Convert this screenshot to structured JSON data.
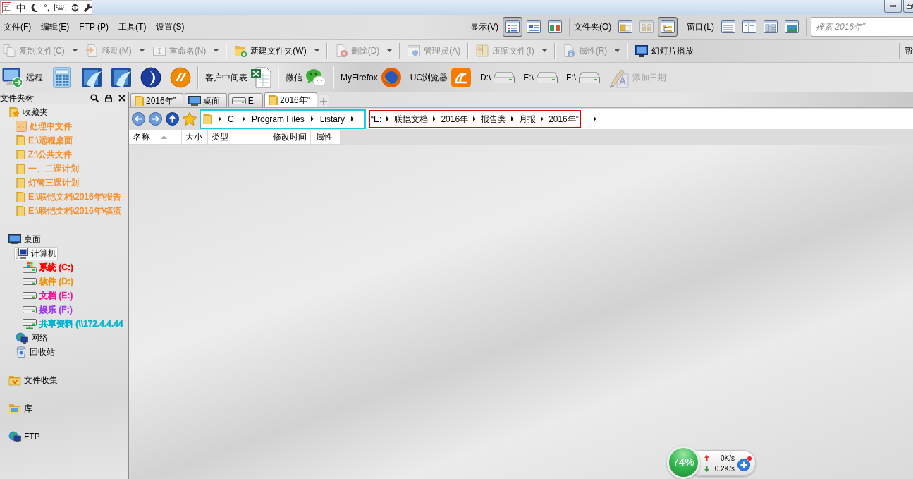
{
  "title_bar": {
    "ime": {
      "logo": "五",
      "mode": "中",
      "punctuation": "°,"
    }
  },
  "menu": [
    "文件(F)",
    "编辑(E)",
    "FTP (P)",
    "工具(T)",
    "设置(S)"
  ],
  "view_groups": [
    {
      "label": "显示(V)",
      "buttons": [
        {
          "selected": true,
          "disabled": false
        },
        {
          "selected": false,
          "disabled": false
        },
        {
          "selected": false,
          "disabled": false
        }
      ]
    },
    {
      "label": "文件夹(O)",
      "buttons": [
        {
          "selected": false,
          "disabled": false
        },
        {
          "selected": false,
          "disabled": true
        },
        {
          "selected": true,
          "disabled": false
        }
      ]
    },
    {
      "label": "窗口(L)",
      "buttons": [
        {
          "selected": false,
          "disabled": false
        },
        {
          "selected": false,
          "disabled": false
        },
        {
          "selected": false,
          "disabled": false
        },
        {
          "selected": false,
          "disabled": false
        }
      ]
    }
  ],
  "search": {
    "placeholder": "搜索 2016年”"
  },
  "toolbar": {
    "groups": [
      [
        {
          "label": "复制文件(C)",
          "disabled": true,
          "dropdown": true
        },
        {
          "label": "移动(M)",
          "disabled": true,
          "dropdown": true
        },
        {
          "label": "重命名(N)",
          "disabled": true,
          "dropdown": true
        }
      ],
      [
        {
          "label": "新建文件夹(W)",
          "disabled": false,
          "dropdown": true
        }
      ],
      [
        {
          "label": "删除(D)",
          "disabled": true,
          "dropdown": true
        }
      ],
      [
        {
          "label": "管理员(A)",
          "disabled": true,
          "dropdown": false
        }
      ],
      [
        {
          "label": "压缩文件(I)",
          "disabled": true,
          "dropdown": true
        }
      ],
      [
        {
          "label": "属性(R)",
          "disabled": true,
          "dropdown": true
        }
      ],
      [
        {
          "label": "幻灯片播放",
          "disabled": false,
          "dropdown": false
        }
      ]
    ],
    "overflow_label": "帮"
  },
  "launch_bar": [
    [
      {
        "kind": "icon-label",
        "label": "远程",
        "disabled": false
      },
      {
        "kind": "icon",
        "disabled": false
      },
      {
        "kind": "icon",
        "disabled": false
      },
      {
        "kind": "icon",
        "disabled": false
      },
      {
        "kind": "icon",
        "disabled": false
      },
      {
        "kind": "icon",
        "disabled": false
      }
    ],
    [
      {
        "kind": "label-icon",
        "label": "客户中间表",
        "disabled": false
      }
    ],
    [
      {
        "kind": "label-icon",
        "label": "微信",
        "disabled": false
      }
    ],
    [
      {
        "kind": "label-icon",
        "label": "MyFirefox",
        "disabled": false
      },
      {
        "kind": "label-icon",
        "label": "UC浏览器",
        "disabled": false
      },
      {
        "kind": "label-icon",
        "label": "D:\\",
        "disabled": false
      },
      {
        "kind": "label-icon",
        "label": "E:\\",
        "disabled": false
      },
      {
        "kind": "label-icon",
        "label": "F:\\",
        "disabled": false
      },
      {
        "kind": "icon-label",
        "label": "添加日期",
        "disabled": true
      }
    ]
  ],
  "sidebar": {
    "title": "文件夹树",
    "tree": [
      {
        "kind": "favorites",
        "label": "收藏夹",
        "selected": false,
        "children": [
          {
            "kind": "shortcut",
            "label": "处理中文件",
            "color": "#f5891f",
            "selected": false
          },
          {
            "kind": "folder",
            "label": "E:\\远程桌面",
            "color": "#f5891f",
            "selected": false
          },
          {
            "kind": "folder",
            "label": "Z:\\公共文件",
            "color": "#f5891f",
            "selected": false
          },
          {
            "kind": "folder",
            "label": "一、二课计划",
            "color": "#f5891f",
            "selected": false
          },
          {
            "kind": "folder",
            "label": "灯管三课计划",
            "color": "#f5891f",
            "selected": false
          },
          {
            "kind": "folder",
            "label": "E:\\联恺文档\\2016年\\报告",
            "color": "#f5891f",
            "selected": false
          },
          {
            "kind": "folder",
            "label": "E:\\联恺文档\\2016年\\镇流",
            "color": "#f5891f",
            "selected": false
          }
        ]
      },
      {
        "kind": "desktop",
        "label": "桌面",
        "selected": false,
        "children": [
          {
            "kind": "computer",
            "label": "计算机",
            "selected": true,
            "children": [
              {
                "kind": "sysdrive",
                "label": "系统 (C:)",
                "color": "#ff0000",
                "selected": false
              },
              {
                "kind": "drive",
                "label": "软件 (D:)",
                "color": "#f39200",
                "selected": false
              },
              {
                "kind": "drive",
                "label": "文档 (E:)",
                "color": "#f0189a",
                "selected": false
              },
              {
                "kind": "drive",
                "label": "娱乐 (F:)",
                "color": "#9d3cf0",
                "selected": false
              },
              {
                "kind": "netdrive",
                "label": "共享资料 (\\\\172.4.4.44",
                "color": "#00b4cc",
                "selected": false
              }
            ]
          },
          {
            "kind": "network",
            "label": "网络",
            "selected": false
          },
          {
            "kind": "recycle",
            "label": "回收站",
            "selected": false
          }
        ]
      },
      {
        "kind": "collection",
        "label": "文件收集",
        "selected": false
      },
      {
        "kind": "library",
        "label": "库",
        "selected": false
      },
      {
        "kind": "ftp",
        "label": "FTP",
        "selected": false
      }
    ]
  },
  "tabs": [
    {
      "kind": "folder",
      "label": "2016年”",
      "selected": false
    },
    {
      "kind": "desktop",
      "label": "桌面",
      "selected": false
    },
    {
      "kind": "drive",
      "label": "E:",
      "selected": false
    },
    {
      "kind": "folder",
      "label": "2016年”",
      "selected": true
    }
  ],
  "address_bar": {
    "segments": [
      {
        "color": "#22c8dc",
        "crumbs": [
          "C:",
          "Program Files",
          "Listary"
        ]
      },
      {
        "color": "#e30000",
        "crumbs": [
          "“E:",
          "联恺文档",
          "2016年",
          "报告类",
          "月报",
          "2016年”"
        ]
      }
    ]
  },
  "columns": [
    {
      "label": "名称",
      "sorted": true
    },
    {
      "label": "大小",
      "sorted": false
    },
    {
      "label": "类型",
      "sorted": false
    },
    {
      "label": "修改时间",
      "sorted": false
    },
    {
      "label": "属性",
      "sorted": false
    }
  ],
  "status_widget": {
    "usage": "74%",
    "upload": "0K/s",
    "download": "0.2K/s"
  }
}
